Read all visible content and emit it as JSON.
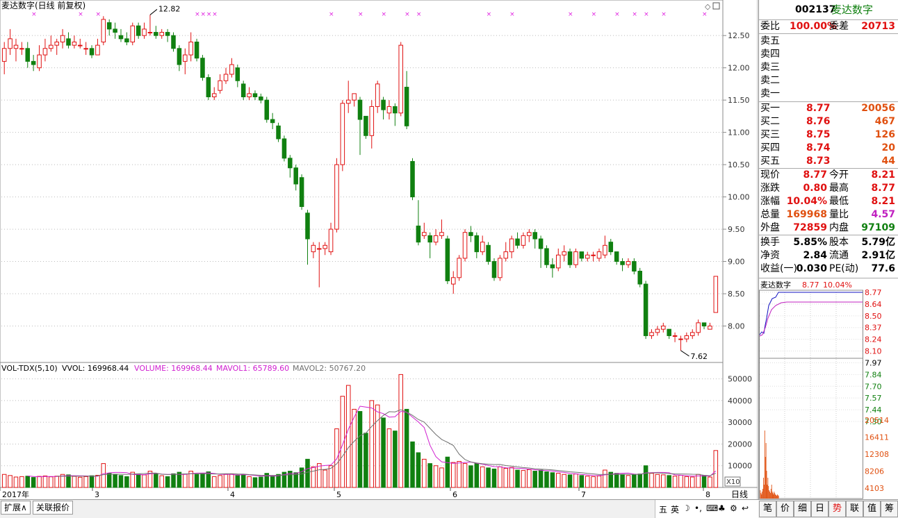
{
  "chart_title": "麦达数字(日线 前复权)",
  "max_label": "12.82",
  "min_label": "7.62",
  "y_ticks": [
    "12.50",
    "12.00",
    "11.50",
    "11.00",
    "10.50",
    "10.00",
    "9.50",
    "9.00",
    "8.50",
    "8.00"
  ],
  "vol_header": {
    "name": "VOL-TDX(5,10)",
    "vvol": "VVOL: 169968.44",
    "volume": "VOLUME: 169968.44",
    "mavol1": "MAVOL1: 65789.60",
    "mavol2": "MAVOL2: 50767.20"
  },
  "vol_ticks": [
    "50000",
    "40000",
    "30000",
    "20000",
    "10000"
  ],
  "vol_unit": "X10",
  "period_label": "日线",
  "x_labels": [
    "2017年",
    "3",
    "4",
    "5",
    "6",
    "7",
    "8"
  ],
  "colors": {
    "up": "#e01010",
    "down": "#108010",
    "mavol1": "#d020d0",
    "mavol2": "#707070",
    "marker": "#e020e0"
  },
  "chart_data": {
    "type": "candlestick",
    "ylim": [
      7.5,
      12.9
    ],
    "vol_ylim": [
      0,
      55000
    ],
    "candles": [
      [
        12.1,
        12.3,
        12.4,
        11.9,
        6000
      ],
      [
        12.3,
        12.45,
        12.6,
        12.2,
        5500
      ],
      [
        12.3,
        12.35,
        12.45,
        12.1,
        4800
      ],
      [
        12.3,
        12.3,
        12.4,
        12.2,
        5000
      ],
      [
        12.3,
        12.1,
        12.4,
        12.0,
        5200
      ],
      [
        12.1,
        12.05,
        12.2,
        11.95,
        4600
      ],
      [
        12.0,
        12.2,
        12.35,
        11.95,
        5100
      ],
      [
        12.2,
        12.3,
        12.45,
        12.1,
        5300
      ],
      [
        12.3,
        12.35,
        12.5,
        12.25,
        4900
      ],
      [
        12.35,
        12.4,
        12.45,
        12.2,
        5200
      ],
      [
        12.4,
        12.5,
        12.6,
        12.3,
        6000
      ],
      [
        12.45,
        12.35,
        12.55,
        12.3,
        5800
      ],
      [
        12.35,
        12.4,
        12.5,
        12.3,
        5100
      ],
      [
        12.35,
        12.35,
        12.45,
        12.3,
        4700
      ],
      [
        12.3,
        12.3,
        12.4,
        12.2,
        5000
      ],
      [
        12.3,
        12.2,
        12.35,
        12.15,
        5400
      ],
      [
        12.2,
        12.35,
        12.45,
        12.2,
        5600
      ],
      [
        12.4,
        12.75,
        12.8,
        12.35,
        11000
      ],
      [
        12.7,
        12.6,
        12.75,
        12.5,
        6500
      ],
      [
        12.6,
        12.55,
        12.7,
        12.45,
        6000
      ],
      [
        12.5,
        12.45,
        12.6,
        12.4,
        5500
      ],
      [
        12.45,
        12.4,
        12.55,
        12.35,
        5000
      ],
      [
        12.4,
        12.65,
        12.7,
        12.35,
        7000
      ],
      [
        12.65,
        12.5,
        12.7,
        12.45,
        6000
      ],
      [
        12.5,
        12.6,
        12.7,
        12.45,
        5800
      ],
      [
        12.55,
        12.55,
        12.82,
        12.5,
        7500
      ],
      [
        12.55,
        12.5,
        12.65,
        12.45,
        6200
      ],
      [
        12.5,
        12.55,
        12.6,
        12.45,
        5400
      ],
      [
        12.55,
        12.5,
        12.6,
        12.4,
        5000
      ],
      [
        12.5,
        12.3,
        12.55,
        12.25,
        6300
      ],
      [
        12.3,
        12.05,
        12.35,
        11.95,
        7000
      ],
      [
        12.1,
        12.2,
        12.3,
        11.9,
        6200
      ],
      [
        12.2,
        12.4,
        12.55,
        12.1,
        7500
      ],
      [
        12.4,
        12.15,
        12.45,
        12.1,
        6000
      ],
      [
        12.15,
        11.85,
        12.2,
        11.8,
        6500
      ],
      [
        11.85,
        11.55,
        11.9,
        11.5,
        7200
      ],
      [
        11.55,
        11.6,
        11.7,
        11.5,
        5000
      ],
      [
        11.65,
        11.8,
        11.9,
        11.6,
        5500
      ],
      [
        11.8,
        11.9,
        12.0,
        11.75,
        6000
      ],
      [
        11.9,
        12.05,
        12.15,
        11.85,
        6200
      ],
      [
        12.0,
        11.8,
        12.05,
        11.7,
        5800
      ],
      [
        11.75,
        11.55,
        11.8,
        11.5,
        6000
      ],
      [
        11.55,
        11.6,
        11.7,
        11.5,
        5000
      ],
      [
        11.6,
        11.55,
        11.65,
        11.5,
        4500
      ],
      [
        11.55,
        11.5,
        11.6,
        11.45,
        4800
      ],
      [
        11.5,
        11.2,
        11.55,
        11.15,
        6500
      ],
      [
        11.2,
        11.15,
        11.3,
        11.05,
        5200
      ],
      [
        11.1,
        10.9,
        11.15,
        10.85,
        6000
      ],
      [
        10.9,
        10.6,
        10.95,
        10.55,
        7000
      ],
      [
        10.6,
        10.45,
        10.65,
        10.3,
        7500
      ],
      [
        10.45,
        10.2,
        10.5,
        10.1,
        6800
      ],
      [
        10.3,
        9.85,
        10.35,
        9.8,
        9000
      ],
      [
        9.75,
        9.35,
        9.8,
        8.95,
        13000
      ],
      [
        9.15,
        9.25,
        9.3,
        9.05,
        9500
      ],
      [
        9.2,
        9.2,
        9.3,
        8.6,
        11000
      ],
      [
        9.2,
        9.25,
        9.3,
        9.1,
        8000
      ],
      [
        9.15,
        9.5,
        9.6,
        9.1,
        10000
      ],
      [
        9.5,
        10.5,
        10.6,
        9.45,
        27000
      ],
      [
        10.5,
        11.45,
        11.5,
        10.4,
        42000
      ],
      [
        11.45,
        11.5,
        11.8,
        11.3,
        47000
      ],
      [
        11.5,
        11.6,
        11.6,
        11.4,
        36000
      ],
      [
        11.5,
        11.2,
        11.55,
        10.65,
        35000
      ],
      [
        11.25,
        10.95,
        11.25,
        10.9,
        25000
      ],
      [
        10.95,
        11.4,
        11.5,
        10.75,
        40000
      ],
      [
        11.4,
        11.75,
        11.8,
        11.3,
        38000
      ],
      [
        11.5,
        11.35,
        11.55,
        11.2,
        32000
      ],
      [
        11.3,
        11.4,
        11.5,
        11.2,
        27000
      ],
      [
        11.4,
        11.3,
        11.45,
        11.1,
        26000
      ],
      [
        11.3,
        12.35,
        12.4,
        11.25,
        52000
      ],
      [
        11.7,
        11.1,
        11.95,
        11.05,
        36000
      ],
      [
        10.55,
        10.0,
        10.6,
        9.95,
        21000
      ],
      [
        9.55,
        9.3,
        9.95,
        9.25,
        16000
      ],
      [
        9.4,
        9.45,
        9.6,
        9.35,
        13000
      ],
      [
        9.4,
        9.3,
        9.45,
        9.05,
        11000
      ],
      [
        9.3,
        9.4,
        9.5,
        9.25,
        10000
      ],
      [
        9.4,
        9.45,
        9.65,
        9.35,
        9000
      ],
      [
        9.35,
        8.7,
        9.4,
        8.65,
        14000
      ],
      [
        8.65,
        8.75,
        8.85,
        8.5,
        11500
      ],
      [
        8.75,
        9.05,
        9.1,
        8.7,
        12000
      ],
      [
        9.05,
        9.45,
        9.5,
        9.0,
        11000
      ],
      [
        9.45,
        9.4,
        9.55,
        9.3,
        10000
      ],
      [
        9.4,
        9.15,
        9.45,
        9.05,
        11000
      ],
      [
        9.15,
        9.3,
        9.4,
        9.1,
        9500
      ],
      [
        9.25,
        9.0,
        9.3,
        8.95,
        9000
      ],
      [
        9.0,
        8.75,
        9.05,
        8.7,
        8500
      ],
      [
        8.75,
        9.05,
        9.1,
        8.7,
        9500
      ],
      [
        9.05,
        9.15,
        9.3,
        9.0,
        8800
      ],
      [
        9.15,
        9.35,
        9.4,
        9.05,
        9200
      ],
      [
        9.35,
        9.25,
        9.45,
        9.2,
        8000
      ],
      [
        9.25,
        9.4,
        9.45,
        9.2,
        7800
      ],
      [
        9.4,
        9.45,
        9.5,
        9.3,
        8200
      ],
      [
        9.45,
        9.35,
        9.5,
        9.2,
        7500
      ],
      [
        9.35,
        9.2,
        9.4,
        8.9,
        8000
      ],
      [
        9.2,
        8.95,
        9.25,
        8.9,
        7200
      ],
      [
        8.95,
        8.9,
        9.05,
        8.75,
        6800
      ],
      [
        8.9,
        9.1,
        9.2,
        8.85,
        6500
      ],
      [
        9.1,
        9.15,
        9.25,
        9.0,
        6000
      ],
      [
        9.15,
        8.95,
        9.2,
        8.9,
        5800
      ],
      [
        8.95,
        9.15,
        9.2,
        8.9,
        6200
      ],
      [
        9.15,
        9.05,
        9.15,
        9.0,
        5500
      ],
      [
        9.05,
        9.1,
        9.15,
        9.0,
        5200
      ],
      [
        9.1,
        9.1,
        9.15,
        9.0,
        5000
      ],
      [
        9.05,
        9.15,
        9.2,
        9.0,
        5300
      ],
      [
        9.1,
        9.25,
        9.4,
        9.05,
        8000
      ],
      [
        9.3,
        9.15,
        9.35,
        9.1,
        7000
      ],
      [
        9.15,
        9.0,
        9.15,
        8.95,
        6500
      ],
      [
        9.0,
        8.95,
        9.05,
        8.85,
        6000
      ],
      [
        8.95,
        9.0,
        9.05,
        8.9,
        5500
      ],
      [
        9.0,
        8.85,
        9.05,
        8.8,
        5800
      ],
      [
        8.85,
        8.65,
        8.9,
        8.6,
        6200
      ],
      [
        8.65,
        7.85,
        8.7,
        7.8,
        10000
      ],
      [
        7.85,
        7.9,
        7.95,
        7.8,
        6500
      ],
      [
        7.9,
        7.95,
        8.0,
        7.85,
        6000
      ],
      [
        7.95,
        8.0,
        8.05,
        7.9,
        5800
      ],
      [
        7.95,
        7.85,
        7.95,
        7.8,
        5500
      ],
      [
        7.85,
        7.85,
        7.9,
        7.75,
        5200
      ],
      [
        7.8,
        7.8,
        7.85,
        7.62,
        5600
      ],
      [
        7.8,
        7.85,
        7.9,
        7.75,
        5000
      ],
      [
        7.85,
        7.9,
        7.95,
        7.8,
        4800
      ],
      [
        7.9,
        8.05,
        8.1,
        7.85,
        6000
      ],
      [
        8.05,
        8.0,
        8.05,
        7.95,
        5500
      ],
      [
        7.95,
        8.0,
        8.05,
        7.95,
        4800
      ],
      [
        8.21,
        8.77,
        8.77,
        8.21,
        16997
      ]
    ],
    "markers": [
      5,
      13,
      16,
      33,
      34,
      35,
      36,
      56,
      61,
      65,
      69,
      71,
      83,
      87,
      97,
      101,
      105,
      108,
      110,
      113,
      120,
      125,
      130,
      144,
      148
    ]
  },
  "quote": {
    "code": "002137",
    "name": "麦达数字",
    "weibi_label": "委比",
    "weibi_val": "100.00%",
    "weicha_label": "委差",
    "weicha_val": "20713",
    "sell": [
      {
        "label": "卖五"
      },
      {
        "label": "卖四"
      },
      {
        "label": "卖三"
      },
      {
        "label": "卖二"
      },
      {
        "label": "卖一"
      }
    ],
    "buy": [
      {
        "label": "买一",
        "price": "8.77",
        "vol": "20056"
      },
      {
        "label": "买二",
        "price": "8.76",
        "vol": "467"
      },
      {
        "label": "买三",
        "price": "8.75",
        "vol": "126"
      },
      {
        "label": "买四",
        "price": "8.74",
        "vol": "20"
      },
      {
        "label": "买五",
        "price": "8.73",
        "vol": "44"
      }
    ],
    "stats": [
      {
        "l1": "现价",
        "v1": "8.77",
        "c1": "red",
        "l2": "今开",
        "v2": "8.21",
        "c2": "red"
      },
      {
        "l1": "涨跌",
        "v1": "0.80",
        "c1": "red",
        "l2": "最高",
        "v2": "8.77",
        "c2": "red"
      },
      {
        "l1": "涨幅",
        "v1": "10.04%",
        "c1": "red",
        "l2": "最低",
        "v2": "8.21",
        "c2": "red"
      },
      {
        "l1": "总量",
        "v1": "169968",
        "c1": "orn",
        "l2": "量比",
        "v2": "4.57",
        "c2": "mag"
      },
      {
        "l1": "外盘",
        "v1": "72859",
        "c1": "red",
        "l2": "内盘",
        "v2": "97109",
        "c2": "grn"
      }
    ],
    "fund": [
      {
        "l1": "换手",
        "v1": "5.85%",
        "l2": "股本",
        "v2": "5.79亿"
      },
      {
        "l1": "净资",
        "v1": "2.84",
        "l2": "流通",
        "v2": "2.91亿"
      },
      {
        "l1": "收益(一)",
        "v1": "0.030",
        "l2": "PE(动)",
        "v2": "77.6"
      }
    ],
    "mini": {
      "name": "麦达数字",
      "price": "8.77",
      "pct": "10.04%",
      "ticks_red": [
        "8.77",
        "8.64",
        "8.50",
        "8.37",
        "8.24",
        "8.10"
      ],
      "tick_mid": "7.97",
      "ticks_grn": [
        "7.84",
        "7.70",
        "7.57",
        "7.44",
        "7.30"
      ],
      "vol_ticks": [
        "20514",
        "16411",
        "12308",
        "8206",
        "4103"
      ]
    }
  },
  "bottom": {
    "tabs": [
      "扩展∧",
      "关联报价"
    ],
    "right_tabs": [
      "笔",
      "价",
      "细",
      "日",
      "势",
      "联",
      "值",
      "筹"
    ],
    "active_tab": "势",
    "tray": [
      "五",
      "英",
      "☽",
      "•,",
      "⌨",
      "♣",
      "⚙",
      "↩"
    ]
  }
}
